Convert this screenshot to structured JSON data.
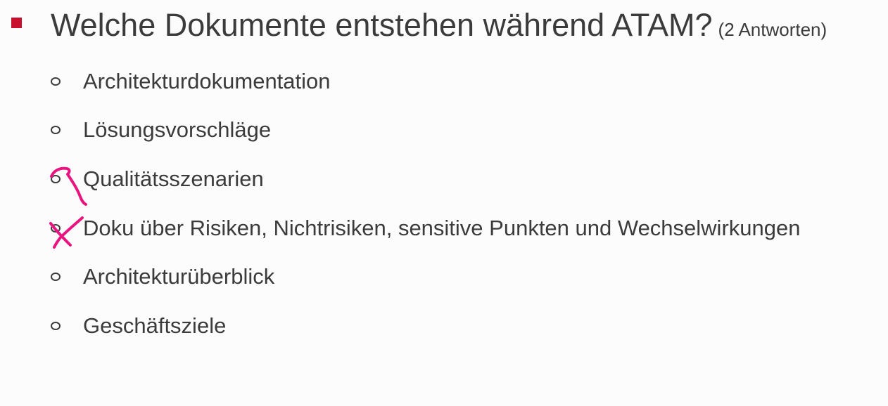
{
  "slide": {
    "question": "Welche Dokumente entstehen während ATAM?",
    "hint": "(2 Antworten)",
    "accent_color": "#c8102e",
    "annotation_color": "#e8147f",
    "options": [
      {
        "label": "Architekturdokumentation",
        "marked": false
      },
      {
        "label": "Lösungsvorschläge",
        "marked": false
      },
      {
        "label": "Qualitätsszenarien",
        "marked": true
      },
      {
        "label": "Doku über Risiken, Nichtrisiken, sensitive Punkten und Wechselwirkungen",
        "marked": true
      },
      {
        "label": "Architekturüberblick",
        "marked": false
      },
      {
        "label": "Geschäftsziele",
        "marked": false
      }
    ]
  }
}
